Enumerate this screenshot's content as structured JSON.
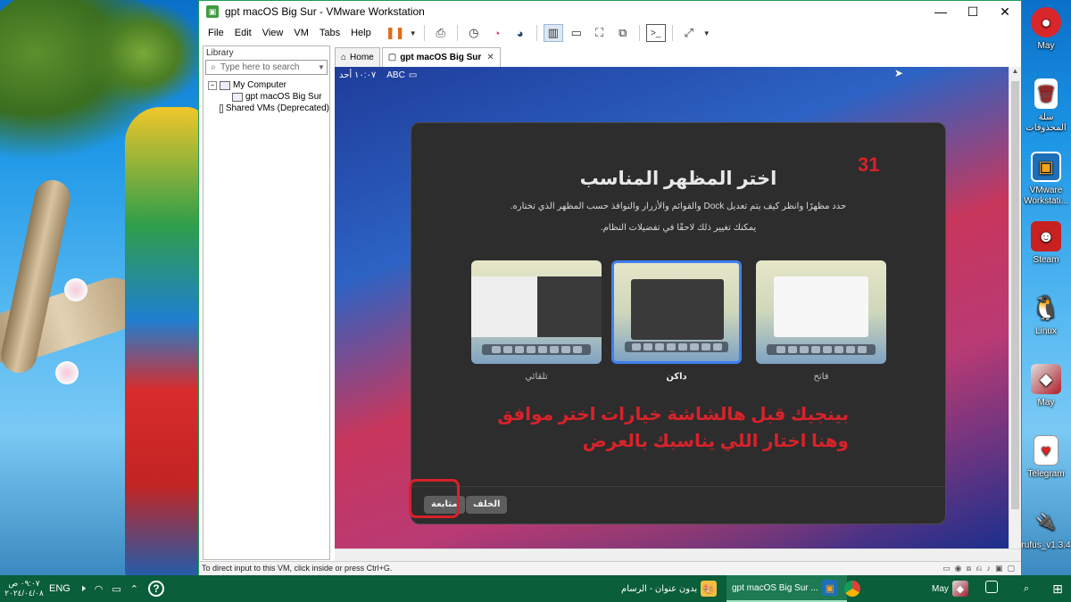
{
  "window": {
    "title": "gpt macOS Big Sur - VMware Workstation",
    "controls": {
      "minimize": "—",
      "maximize": "☐",
      "close": "✕"
    }
  },
  "menu": [
    "File",
    "Edit",
    "View",
    "VM",
    "Tabs",
    "Help"
  ],
  "library": {
    "header": "Library",
    "search_placeholder": "Type here to search",
    "tree": {
      "my_computer": "My Computer",
      "vm": "gpt macOS Big Sur",
      "shared": "Shared VMs (Deprecated)"
    }
  },
  "tabs": [
    {
      "label": "Home",
      "icon": "home-icon"
    },
    {
      "label": "gpt macOS Big Sur",
      "icon": "vm-icon",
      "close": "✕"
    }
  ],
  "vm_status": {
    "time": "١٠:٠٧ أحد",
    "input": "ABC"
  },
  "setup": {
    "step_number": "31",
    "title": "اختر المظهر المناسب",
    "desc1": "حدد مظهرًا وانظر كيف يتم تعديل Dock والقوائم والأزرار والنوافذ حسب المظهر الذي تختاره.",
    "desc2": "يمكنك تغيير ذلك لاحقًا في تفضيلات النظام.",
    "options": [
      {
        "label": "تلقائي",
        "selected": false
      },
      {
        "label": "داكن",
        "selected": true
      },
      {
        "label": "فاتح",
        "selected": false
      }
    ],
    "annotation_line1": "بينجيك قبل هالشاشة خيارات اختر موافق",
    "annotation_line2": "وهنا اختار اللي يناسبك بالعرض",
    "back_button": "الخلف",
    "continue_button": "متابعة",
    "accent_color": "#3f7ff0",
    "annotation_color": "#d8222a"
  },
  "statusbar": {
    "message": "To direct input to this VM, click inside or press Ctrl+G."
  },
  "desktop_icons": [
    {
      "label": "May",
      "icon": "angry-bird-icon"
    },
    {
      "label": "سلة المحذوفات",
      "icon": "recycle-bin-icon"
    },
    {
      "label": "VMware Workstati...",
      "icon": "vmware-icon"
    },
    {
      "label": "Steam",
      "icon": "steam-icon"
    },
    {
      "label": "Linux",
      "icon": "linux-icon"
    },
    {
      "label": "May",
      "icon": "game-icon"
    },
    {
      "label": "Telegram",
      "icon": "card-icon"
    },
    {
      "label": "rufus_v1.3.4",
      "icon": "usb-icon"
    }
  ],
  "taskbar": {
    "clock_time": "٠٩:٠٧ ص",
    "clock_date": "٢٠٢٤/٠٤/٠٨",
    "lang": "ENG",
    "items": [
      {
        "label": "بدون عنوان - الرسام",
        "icon": "paint-icon"
      },
      {
        "label": "gpt macOS Big Sur ...",
        "icon": "vmware-icon"
      },
      {
        "label": "",
        "icon": "chrome-icon"
      },
      {
        "label": "May",
        "icon": "game-icon"
      }
    ]
  }
}
